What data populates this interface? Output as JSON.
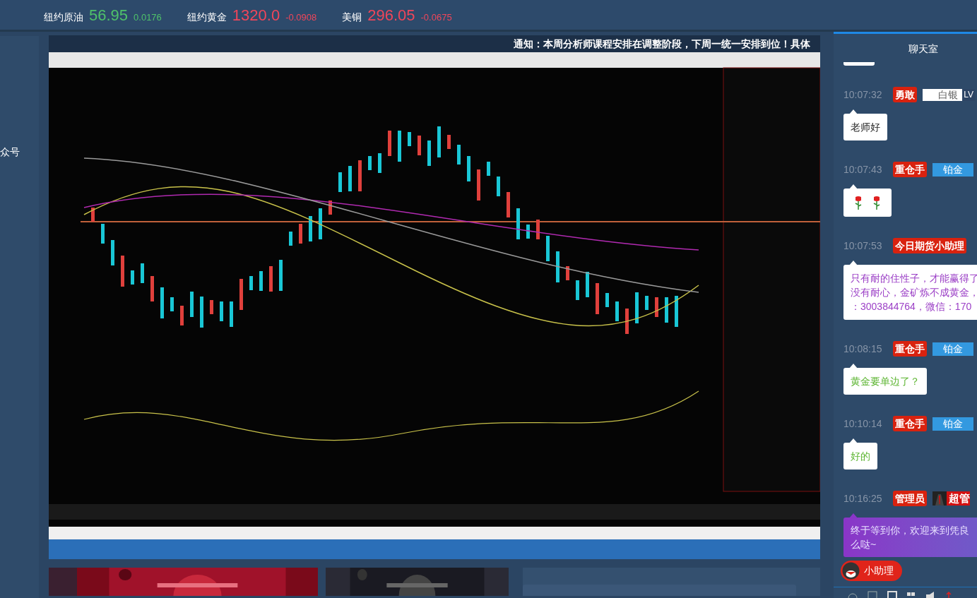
{
  "ticker": [
    {
      "name": "纽约原油",
      "price": "56.95",
      "change": "0.0176",
      "color": "#4fc26a"
    },
    {
      "name": "纽约黄金",
      "price": "1320.0",
      "change": "-0.0908",
      "color": "#f0465a"
    },
    {
      "name": "美铜",
      "price": "296.05",
      "change": "-0.0675",
      "color": "#f0465a"
    }
  ],
  "side_panel": {
    "label": "众号"
  },
  "notice": "通知：本周分析师课程安排在调整阶段，下周一统一安排到位！具体",
  "video": {
    "kind": "picture"
  },
  "banners": [
    {
      "kind": "picture"
    },
    {
      "kind": "picture"
    },
    {
      "kind": "panel"
    }
  ],
  "chat": {
    "title": "聊天室",
    "messages": [
      {
        "time": "10:07:32",
        "role": "勇敢",
        "badge": {
          "kind": "silver",
          "label": "白银",
          "level": "LV"
        },
        "kind": "text",
        "color": "#222222",
        "lines": [
          "老师好"
        ]
      },
      {
        "time": "10:07:43",
        "role": "重仓手",
        "badge": {
          "kind": "platinum",
          "label": "铂金"
        },
        "kind": "roses"
      },
      {
        "time": "10:07:53",
        "role": "今日期货小助理",
        "kind": "text",
        "color": "#9b3fc6",
        "lines": [
          "只有耐的住性子，才能赢得了",
          "没有耐心，金矿炼不成黄金，",
          "：3003844764，微信：170"
        ]
      },
      {
        "time": "10:08:15",
        "role": "重仓手",
        "badge": {
          "kind": "platinum",
          "label": "铂金"
        },
        "kind": "text",
        "color": "#5cb531",
        "lines": [
          "黄金要单边了？"
        ]
      },
      {
        "time": "10:10:14",
        "role": "重仓手",
        "badge": {
          "kind": "platinum",
          "label": "铂金"
        },
        "kind": "text",
        "color": "#5cb531",
        "lines": [
          "好的"
        ]
      },
      {
        "time": "10:16:25",
        "role": "管理员",
        "badge": {
          "kind": "admin",
          "label": "超管"
        },
        "kind": "announcement",
        "color": "#e8e0ff",
        "lines": [
          "终于等到你，欢迎来到凭良",
          "么哒~"
        ]
      }
    ],
    "helper": "小助理"
  }
}
